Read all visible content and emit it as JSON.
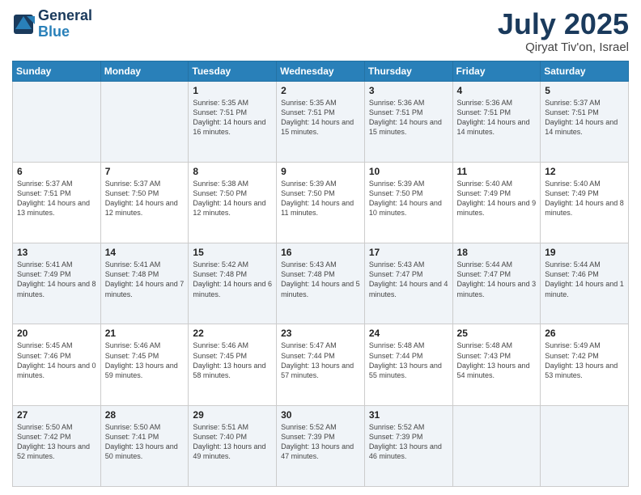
{
  "logo": {
    "line1": "General",
    "line2": "Blue"
  },
  "title": "July 2025",
  "location": "Qiryat Tiv'on, Israel",
  "weekdays": [
    "Sunday",
    "Monday",
    "Tuesday",
    "Wednesday",
    "Thursday",
    "Friday",
    "Saturday"
  ],
  "weeks": [
    [
      null,
      null,
      {
        "day": "1",
        "sunrise": "5:35 AM",
        "sunset": "7:51 PM",
        "daylight": "14 hours and 16 minutes."
      },
      {
        "day": "2",
        "sunrise": "5:35 AM",
        "sunset": "7:51 PM",
        "daylight": "14 hours and 15 minutes."
      },
      {
        "day": "3",
        "sunrise": "5:36 AM",
        "sunset": "7:51 PM",
        "daylight": "14 hours and 15 minutes."
      },
      {
        "day": "4",
        "sunrise": "5:36 AM",
        "sunset": "7:51 PM",
        "daylight": "14 hours and 14 minutes."
      },
      {
        "day": "5",
        "sunrise": "5:37 AM",
        "sunset": "7:51 PM",
        "daylight": "14 hours and 14 minutes."
      }
    ],
    [
      {
        "day": "6",
        "sunrise": "5:37 AM",
        "sunset": "7:51 PM",
        "daylight": "14 hours and 13 minutes."
      },
      {
        "day": "7",
        "sunrise": "5:37 AM",
        "sunset": "7:50 PM",
        "daylight": "14 hours and 12 minutes."
      },
      {
        "day": "8",
        "sunrise": "5:38 AM",
        "sunset": "7:50 PM",
        "daylight": "14 hours and 12 minutes."
      },
      {
        "day": "9",
        "sunrise": "5:39 AM",
        "sunset": "7:50 PM",
        "daylight": "14 hours and 11 minutes."
      },
      {
        "day": "10",
        "sunrise": "5:39 AM",
        "sunset": "7:50 PM",
        "daylight": "14 hours and 10 minutes."
      },
      {
        "day": "11",
        "sunrise": "5:40 AM",
        "sunset": "7:49 PM",
        "daylight": "14 hours and 9 minutes."
      },
      {
        "day": "12",
        "sunrise": "5:40 AM",
        "sunset": "7:49 PM",
        "daylight": "14 hours and 8 minutes."
      }
    ],
    [
      {
        "day": "13",
        "sunrise": "5:41 AM",
        "sunset": "7:49 PM",
        "daylight": "14 hours and 8 minutes."
      },
      {
        "day": "14",
        "sunrise": "5:41 AM",
        "sunset": "7:48 PM",
        "daylight": "14 hours and 7 minutes."
      },
      {
        "day": "15",
        "sunrise": "5:42 AM",
        "sunset": "7:48 PM",
        "daylight": "14 hours and 6 minutes."
      },
      {
        "day": "16",
        "sunrise": "5:43 AM",
        "sunset": "7:48 PM",
        "daylight": "14 hours and 5 minutes."
      },
      {
        "day": "17",
        "sunrise": "5:43 AM",
        "sunset": "7:47 PM",
        "daylight": "14 hours and 4 minutes."
      },
      {
        "day": "18",
        "sunrise": "5:44 AM",
        "sunset": "7:47 PM",
        "daylight": "14 hours and 3 minutes."
      },
      {
        "day": "19",
        "sunrise": "5:44 AM",
        "sunset": "7:46 PM",
        "daylight": "14 hours and 1 minute."
      }
    ],
    [
      {
        "day": "20",
        "sunrise": "5:45 AM",
        "sunset": "7:46 PM",
        "daylight": "14 hours and 0 minutes."
      },
      {
        "day": "21",
        "sunrise": "5:46 AM",
        "sunset": "7:45 PM",
        "daylight": "13 hours and 59 minutes."
      },
      {
        "day": "22",
        "sunrise": "5:46 AM",
        "sunset": "7:45 PM",
        "daylight": "13 hours and 58 minutes."
      },
      {
        "day": "23",
        "sunrise": "5:47 AM",
        "sunset": "7:44 PM",
        "daylight": "13 hours and 57 minutes."
      },
      {
        "day": "24",
        "sunrise": "5:48 AM",
        "sunset": "7:44 PM",
        "daylight": "13 hours and 55 minutes."
      },
      {
        "day": "25",
        "sunrise": "5:48 AM",
        "sunset": "7:43 PM",
        "daylight": "13 hours and 54 minutes."
      },
      {
        "day": "26",
        "sunrise": "5:49 AM",
        "sunset": "7:42 PM",
        "daylight": "13 hours and 53 minutes."
      }
    ],
    [
      {
        "day": "27",
        "sunrise": "5:50 AM",
        "sunset": "7:42 PM",
        "daylight": "13 hours and 52 minutes."
      },
      {
        "day": "28",
        "sunrise": "5:50 AM",
        "sunset": "7:41 PM",
        "daylight": "13 hours and 50 minutes."
      },
      {
        "day": "29",
        "sunrise": "5:51 AM",
        "sunset": "7:40 PM",
        "daylight": "13 hours and 49 minutes."
      },
      {
        "day": "30",
        "sunrise": "5:52 AM",
        "sunset": "7:39 PM",
        "daylight": "13 hours and 47 minutes."
      },
      {
        "day": "31",
        "sunrise": "5:52 AM",
        "sunset": "7:39 PM",
        "daylight": "13 hours and 46 minutes."
      },
      null,
      null
    ]
  ]
}
